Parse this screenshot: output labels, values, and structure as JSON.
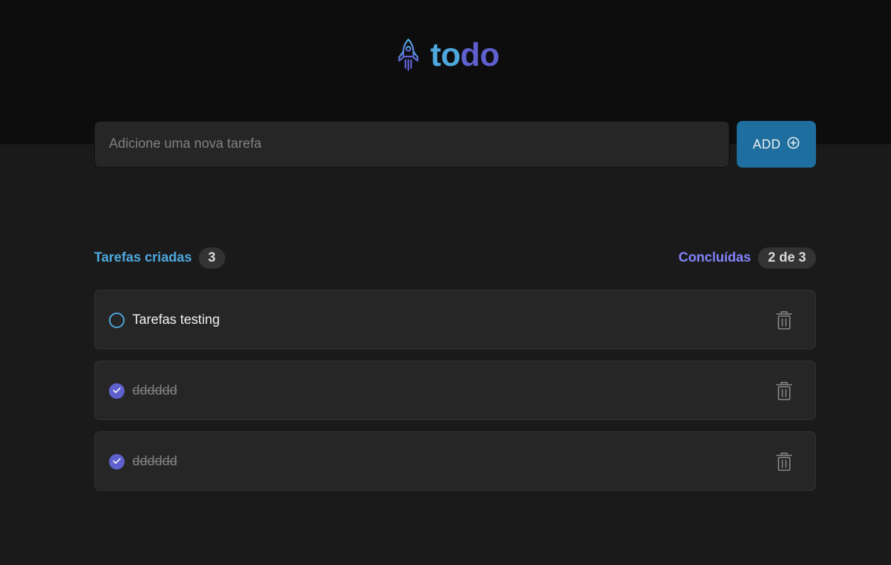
{
  "colors": {
    "header_bg": "#0d0d0d",
    "page_bg": "#1a1a1a",
    "card_bg": "#262626",
    "blue": "#4ea8de",
    "purple": "#5e60ce",
    "purple_light": "#8284fa",
    "button": "#1e6f9f"
  },
  "header": {
    "logo_icon": "rocket-icon",
    "logo_part1": "to",
    "logo_part2": "do"
  },
  "new_task": {
    "placeholder": "Adicione uma nova tarefa",
    "value": "",
    "add_label": "ADD",
    "add_icon": "plus-circle-icon"
  },
  "counters": {
    "created_label": "Tarefas criadas",
    "created_count": "3",
    "done_label": "Concluídas",
    "done_count": "2 de 3"
  },
  "tasks": [
    {
      "text": "Tarefas testing",
      "done": false
    },
    {
      "text": "dddddd",
      "done": true
    },
    {
      "text": "dddddd",
      "done": true
    }
  ]
}
